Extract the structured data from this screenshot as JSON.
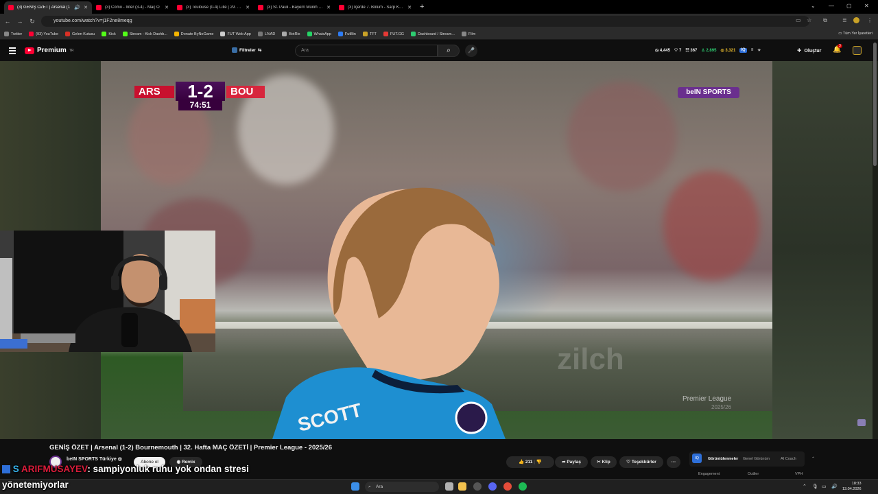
{
  "browser": {
    "tabs": [
      {
        "label": "(3) GENİŞ ÖZET | Arsenal (1",
        "active": true
      },
      {
        "label": "(3) Como - Inter (3-4) - Maç Ö",
        "active": false
      },
      {
        "label": "(3) Toulouse (0-4) Lille | 29. Haf",
        "active": false
      },
      {
        "label": "(3) St. Pauli - Bayern Münih | B",
        "active": false
      },
      {
        "label": "(3) İçerde 7. Bölüm - Sarp Katli",
        "active": false
      }
    ],
    "new_tab": "+",
    "url": "youtube.com/watch?v=j1F2ne8meqg",
    "bookmarks": [
      {
        "label": "Twitter",
        "color": "#888888"
      },
      {
        "label": "(93) YouTube",
        "color": "#ff0033"
      },
      {
        "label": "Gelen Kutusu",
        "color": "#d93025"
      },
      {
        "label": "Kick",
        "color": "#53fc18"
      },
      {
        "label": "Stream - Kick Dashb...",
        "color": "#53fc18"
      },
      {
        "label": "Donate ByNoGame",
        "color": "#f4b400"
      },
      {
        "label": "FUT Web App",
        "color": "#cccccc"
      },
      {
        "label": "LIVAD",
        "color": "#777777"
      },
      {
        "label": "BotRix",
        "color": "#aaaaaa"
      },
      {
        "label": "WhatsApp",
        "color": "#25d366"
      },
      {
        "label": "FutBin",
        "color": "#2e7df6"
      },
      {
        "label": "TFT",
        "color": "#c9a227"
      },
      {
        "label": "FUT.GG",
        "color": "#e53935"
      },
      {
        "label": "Dashboard / Stream...",
        "color": "#2ecc71"
      },
      {
        "label": "Film",
        "color": "#888888"
      }
    ],
    "all_bookmarks": "Tüm Yer İşaretleri"
  },
  "youtube": {
    "logo": "Premium",
    "logo_country": "TR",
    "filters": "Filtreler",
    "search_placeholder": "Ara",
    "stats": [
      {
        "value": "4,445",
        "color": "#f1f1f1"
      },
      {
        "value": "7",
        "color": "#f1f1f1"
      },
      {
        "value": "367",
        "color": "#f1f1f1"
      },
      {
        "value": "2,895",
        "color": "#2ecc71"
      },
      {
        "value": "3,321",
        "color": "#f4c430"
      }
    ],
    "create": "Oluştur",
    "notifications": "3"
  },
  "video": {
    "scorebug": {
      "home": "ARS",
      "score": "1-2",
      "away": "BOU",
      "clock": "74:51"
    },
    "broadcaster": "beIN SPORTS",
    "watermark": "Premier League",
    "watermark_season": "2025/26",
    "jersey_name": "SCOTT",
    "ad_board": "zilch"
  },
  "below": {
    "title": "GENİŞ ÖZET | Arsenal (1-2) Bournemouth | 32. Hafta MAÇ ÖZETİ | Premier League - 2025/26",
    "channel": "beIN SPORTS Türkiye",
    "subscribe": "Abone ol",
    "remix": "Remix",
    "likes": "211",
    "share": "Paylaş",
    "clip": "Klip",
    "thanks": "Teşekkürler",
    "more": "···",
    "vidiq_tabs": [
      "Görüntülenmeler",
      "Genel Görünüm",
      "AI Coach"
    ],
    "vidiq_bottom": [
      "Engagement",
      "Outlier",
      "VPH"
    ]
  },
  "chat": {
    "user": "ARIFMUSAYEV",
    "message": ": sampiyonluk ruhu yok ondan stresi",
    "line2": "yönetemiyorlar"
  },
  "taskbar": {
    "search": "Ara",
    "time": "18:33",
    "date": "13.04.2026"
  }
}
